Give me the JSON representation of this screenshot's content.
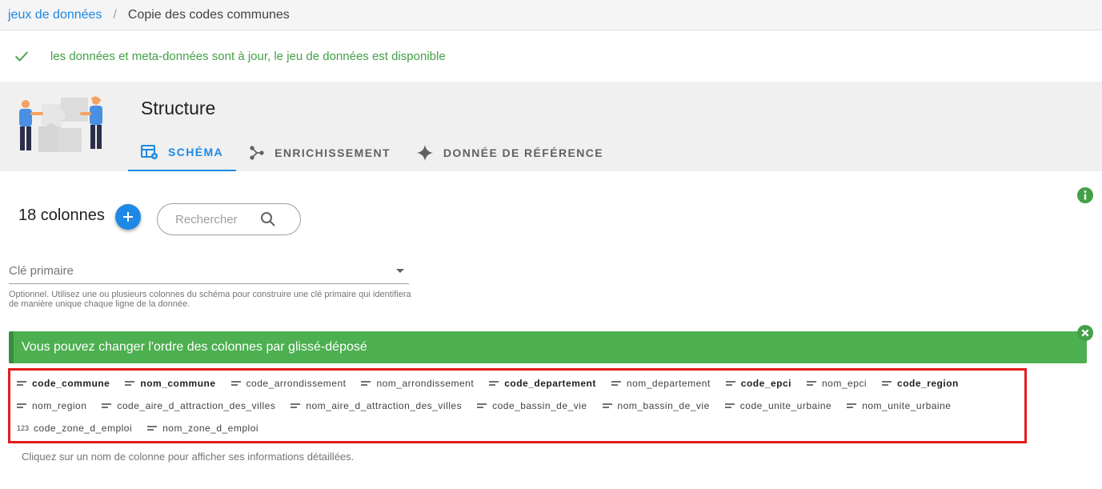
{
  "breadcrumb": {
    "parent": "jeux de données",
    "separator": "/",
    "current": "Copie des codes communes"
  },
  "status": {
    "message": "les données et meta-données sont à jour, le jeu de données est disponible",
    "color": "#43a047",
    "icon": "check-icon"
  },
  "section": {
    "title": "Structure",
    "tabs": [
      {
        "label": "SCHÉMA",
        "icon": "table-gear-icon",
        "active": true
      },
      {
        "label": "ENRICHISSEMENT",
        "icon": "graph-nodes-icon",
        "active": false
      },
      {
        "label": "DONNÉE DE RÉFÉRENCE",
        "icon": "sparkle-icon",
        "active": false
      }
    ]
  },
  "schema": {
    "count_label": "18 colonnes",
    "search_placeholder": "Rechercher",
    "primary_key_label": "Clé primaire",
    "primary_key_hint": "Optionnel. Utilisez une ou plusieurs colonnes du schéma pour construire une clé primaire qui identifiera de manière unique chaque ligne de la donnée.",
    "drag_alert": "Vous pouvez changer l'ordre des colonnes par glissé-déposé",
    "footer_hint": "Cliquez sur un nom de colonne pour afficher ses informations détaillées.",
    "columns": [
      {
        "name": "code_commune",
        "type": "text",
        "bold": true
      },
      {
        "name": "nom_commune",
        "type": "text",
        "bold": true
      },
      {
        "name": "code_arrondissement",
        "type": "text",
        "bold": false
      },
      {
        "name": "nom_arrondissement",
        "type": "text",
        "bold": false
      },
      {
        "name": "code_departement",
        "type": "text",
        "bold": true
      },
      {
        "name": "nom_departement",
        "type": "text",
        "bold": false
      },
      {
        "name": "code_epci",
        "type": "text",
        "bold": true
      },
      {
        "name": "nom_epci",
        "type": "text",
        "bold": false
      },
      {
        "name": "code_region",
        "type": "text",
        "bold": true
      },
      {
        "name": "nom_region",
        "type": "text",
        "bold": false
      },
      {
        "name": "code_aire_d_attraction_des_villes",
        "type": "text",
        "bold": false
      },
      {
        "name": "nom_aire_d_attraction_des_villes",
        "type": "text",
        "bold": false
      },
      {
        "name": "code_bassin_de_vie",
        "type": "text",
        "bold": false
      },
      {
        "name": "nom_bassin_de_vie",
        "type": "text",
        "bold": false
      },
      {
        "name": "code_unite_urbaine",
        "type": "text",
        "bold": false
      },
      {
        "name": "nom_unite_urbaine",
        "type": "text",
        "bold": false
      },
      {
        "name": "code_zone_d_emploi",
        "type": "number",
        "type_label": "123",
        "bold": false
      },
      {
        "name": "nom_zone_d_emploi",
        "type": "text",
        "bold": false
      }
    ]
  },
  "colors": {
    "accent": "#1e88e5",
    "success": "#4caf50",
    "highlight_border": "#e41b1b"
  }
}
